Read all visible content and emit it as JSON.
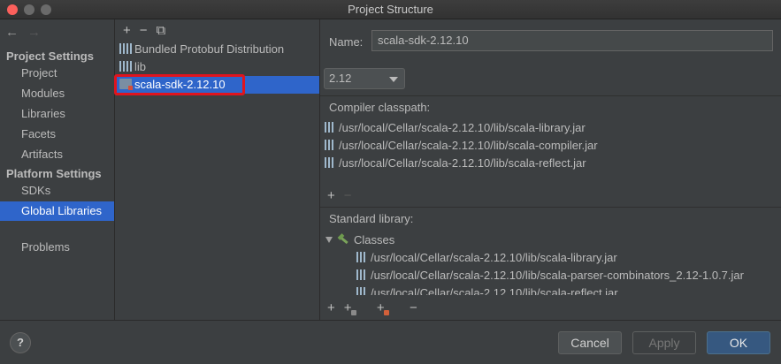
{
  "window": {
    "title": "Project Structure"
  },
  "nav": {
    "back_icon": "arrow-left-icon",
    "forward_icon": "arrow-right-icon",
    "project_settings_header": "Project Settings",
    "platform_settings_header": "Platform Settings",
    "items": [
      {
        "label": "Project"
      },
      {
        "label": "Modules"
      },
      {
        "label": "Libraries"
      },
      {
        "label": "Facets"
      },
      {
        "label": "Artifacts"
      },
      {
        "label": "SDKs"
      },
      {
        "label": "Global Libraries",
        "selected": true
      },
      {
        "label": "Problems"
      }
    ]
  },
  "library_list": {
    "toolbar": {
      "add": "+",
      "remove": "−",
      "copy_icon": "copy-icon"
    },
    "items": [
      {
        "label": "Bundled Protobuf Distribution"
      },
      {
        "label": "lib"
      },
      {
        "label": "scala-sdk-2.12.10",
        "selected": true
      }
    ]
  },
  "details": {
    "name_label": "Name:",
    "name_value": "scala-sdk-2.12.10",
    "version_value": "2.12",
    "compiler_classpath_header": "Compiler classpath:",
    "compiler_classpath": [
      "/usr/local/Cellar/scala-2.12.10/lib/scala-library.jar",
      "/usr/local/Cellar/scala-2.12.10/lib/scala-compiler.jar",
      "/usr/local/Cellar/scala-2.12.10/lib/scala-reflect.jar"
    ],
    "classpath_tools": {
      "add": "+",
      "remove": "−"
    },
    "standard_library_header": "Standard library:",
    "classes_label": "Classes",
    "standard_library": [
      "/usr/local/Cellar/scala-2.12.10/lib/scala-library.jar",
      "/usr/local/Cellar/scala-2.12.10/lib/scala-parser-combinators_2.12-1.0.7.jar",
      "/usr/local/Cellar/scala-2.12.10/lib/scala-reflect.jar"
    ],
    "std_tools": {
      "add": "+",
      "add_root": "+",
      "add_jar": "+",
      "remove": "−"
    }
  },
  "footer": {
    "help_label": "?",
    "cancel_label": "Cancel",
    "apply_label": "Apply",
    "ok_label": "OK"
  },
  "colors": {
    "selection": "#2f65ca",
    "highlight_box": "#e0141e",
    "ok_button": "#365880"
  }
}
